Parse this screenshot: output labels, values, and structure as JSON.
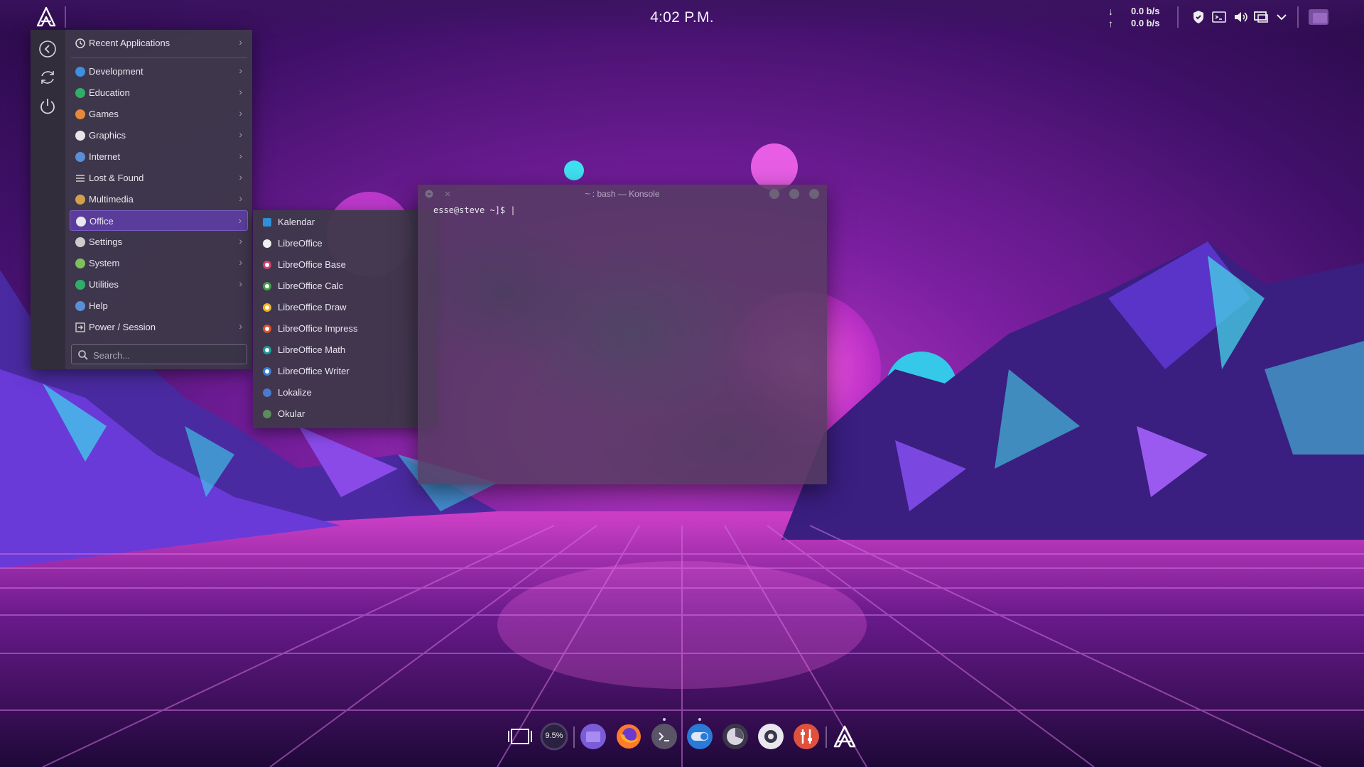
{
  "panel": {
    "clock": "4:02 P.M.",
    "net_down_arrow": "↓",
    "net_up_arrow": "↑",
    "net_down": "0.0 b/s",
    "net_up": "0.0 b/s",
    "tray_icons": [
      "shield-icon",
      "terminal-icon",
      "volume-icon",
      "display-icon",
      "chevron-down-icon"
    ]
  },
  "menu": {
    "recent_label": "Recent Applications",
    "categories": [
      {
        "label": "Development",
        "color": "#3d8fe0"
      },
      {
        "label": "Education",
        "color": "#2fae6a"
      },
      {
        "label": "Games",
        "color": "#e58a3c"
      },
      {
        "label": "Graphics",
        "color": "#e6e6e6"
      },
      {
        "label": "Internet",
        "color": "#5a8fd8"
      },
      {
        "label": "Lost & Found",
        "color": "#d0d0d0"
      },
      {
        "label": "Multimedia",
        "color": "#d2a04a"
      },
      {
        "label": "Office",
        "color": "#e8e8f0"
      },
      {
        "label": "Settings",
        "color": "#cccccc"
      },
      {
        "label": "System",
        "color": "#7ec05a"
      },
      {
        "label": "Utilities",
        "color": "#2fae6a"
      },
      {
        "label": "Help",
        "color": "#5a8fd8"
      },
      {
        "label": "Power / Session",
        "color": "#d0d0d0"
      }
    ],
    "active_category": "Office",
    "chevron": "›",
    "search_placeholder": "Search..."
  },
  "submenu": {
    "items": [
      {
        "label": "Kalendar",
        "color": "#2f8fd8"
      },
      {
        "label": "LibreOffice",
        "color": "#f0f0f0"
      },
      {
        "label": "LibreOffice Base",
        "color": "#c9446f"
      },
      {
        "label": "LibreOffice Calc",
        "color": "#43a047"
      },
      {
        "label": "LibreOffice Draw",
        "color": "#f2b21a"
      },
      {
        "label": "LibreOffice Impress",
        "color": "#d9542c"
      },
      {
        "label": "LibreOffice Math",
        "color": "#1f9b9b"
      },
      {
        "label": "LibreOffice Writer",
        "color": "#3a7fd0"
      },
      {
        "label": "Lokalize",
        "color": "#4a7ad0"
      },
      {
        "label": "Okular",
        "color": "#5a8d5a"
      }
    ]
  },
  "konsole": {
    "title": "~ : bash — Konsole",
    "prompt": "esse@steve ~]$ |"
  },
  "dock": {
    "cpu": "9.5%",
    "apps": [
      "desktop-switch-icon",
      "cpu-monitor-icon",
      "files-icon",
      "firefox-icon",
      "terminal-icon",
      "settings-toggle-icon",
      "disk-usage-icon",
      "media-icon",
      "mixer-icon",
      "arcolinux-icon"
    ]
  },
  "colors": {
    "accent": "#5a3d9a",
    "menu_bg": "#3e384a",
    "wallpaper_top": "#4a1470",
    "wallpaper_glow": "#d03bd0",
    "cyan": "#45d6e8"
  }
}
